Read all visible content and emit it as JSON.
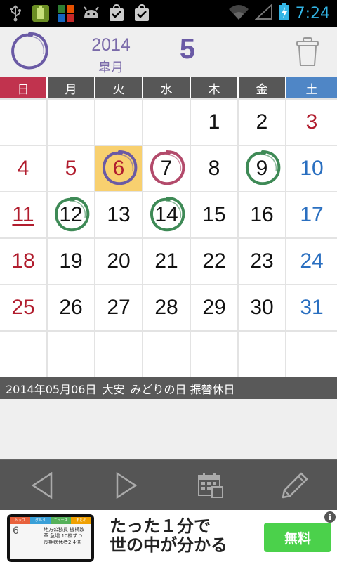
{
  "status_bar": {
    "time": "7:24",
    "icons": [
      "usb-icon",
      "battery-widget-icon",
      "app-icon",
      "android-debug-icon",
      "download-done-icon",
      "download-done-icon",
      "wifi-icon",
      "signal-icon",
      "battery-charging-icon"
    ]
  },
  "header": {
    "year": "2014",
    "month_name": "皐月",
    "month_number": "5"
  },
  "weekdays": [
    "日",
    "月",
    "火",
    "水",
    "木",
    "金",
    "土"
  ],
  "calendar": {
    "rows": [
      [
        null,
        null,
        null,
        null,
        "1",
        "2",
        "3"
      ],
      [
        "4",
        "5",
        "6",
        "7",
        "8",
        "9",
        "10"
      ],
      [
        "11",
        "12",
        "13",
        "14",
        "15",
        "16",
        "17"
      ],
      [
        "18",
        "19",
        "20",
        "21",
        "22",
        "23",
        "24"
      ],
      [
        "25",
        "26",
        "27",
        "28",
        "29",
        "30",
        "31"
      ],
      [
        null,
        null,
        null,
        null,
        null,
        null,
        null
      ]
    ],
    "holidays": [
      "3",
      "4",
      "5",
      "6"
    ],
    "today": "6",
    "underlined": [
      "11"
    ],
    "marks": {
      "6": "#6a5aa5",
      "7": "#b34a6b",
      "9": "#3e8a56",
      "12": "#3e8a56",
      "14": "#3e8a56"
    },
    "colors": {
      "sunday": "#b11d2e",
      "saturday": "#2a6fc0",
      "today_bg": "#f8d06f"
    }
  },
  "info_bar": {
    "date": "2014年05月06日",
    "rokuyo": "大安",
    "holiday": "みどりの日 振替休日"
  },
  "ad": {
    "headline_line1": "たった１分で",
    "headline_line2": "世の中が分かる",
    "cta": "無料",
    "info": "i",
    "mini_tabs": [
      "トップ",
      "グルメ",
      "ニュース",
      "まとめ"
    ],
    "mini_text": "地方公務員 機構改革 急増 10校ずつ 長期病休者2.4倍",
    "mini_temp": "6"
  }
}
